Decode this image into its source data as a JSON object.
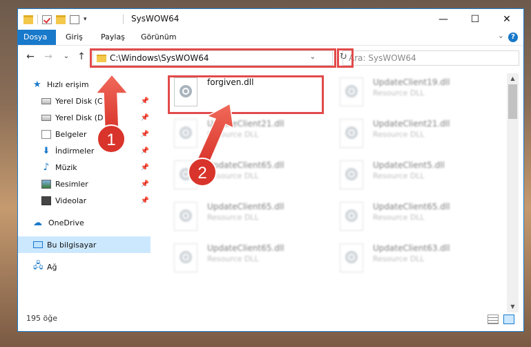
{
  "window": {
    "title": "SysWOW64"
  },
  "window_controls": {
    "minimize": "—",
    "maximize": "☐",
    "close": "✕"
  },
  "ribbon": {
    "tabs": [
      {
        "label": "Dosya",
        "active": true
      },
      {
        "label": "Giriş",
        "active": false
      },
      {
        "label": "Paylaş",
        "active": false
      },
      {
        "label": "Görünüm",
        "active": false
      }
    ],
    "help": "?",
    "expand": "⌄"
  },
  "nav_buttons": {
    "back": "←",
    "forward": "→",
    "recent": "⌄",
    "up": "↑"
  },
  "address": {
    "path": "C:\\Windows\\SysWOW64",
    "chevron": "⌄",
    "refresh": "↻"
  },
  "search": {
    "placeholder": "Ara: SysWOW64"
  },
  "sidebar": {
    "items": [
      {
        "label": "Hızlı erişim"
      },
      {
        "label": "Yerel Disk (C:)",
        "pinned": true
      },
      {
        "label": "Yerel Disk (D:)",
        "pinned": true
      },
      {
        "label": "Belgeler",
        "pinned": true
      },
      {
        "label": "İndirmeler",
        "pinned": true
      },
      {
        "label": "Müzik",
        "pinned": true
      },
      {
        "label": "Resimler",
        "pinned": true
      },
      {
        "label": "Videolar",
        "pinned": true
      },
      {
        "label": "OneDrive"
      },
      {
        "label": "Bu bilgisayar",
        "selected": true
      },
      {
        "label": "Ağ"
      }
    ]
  },
  "files": [
    {
      "name": "forgiven.dll",
      "type": "",
      "focused": true
    },
    {
      "name": "UpdateClient19.dll",
      "type": "Resource DLL"
    },
    {
      "name": "UpdateClient21.dll",
      "type": "Resource DLL"
    },
    {
      "name": "UpdateClient21.dll",
      "type": "Resource DLL"
    },
    {
      "name": "UpdateClient65.dll",
      "type": "Resource DLL"
    },
    {
      "name": "UpdateClient5.dll",
      "type": "Resource DLL"
    },
    {
      "name": "UpdateClient65.dll",
      "type": "Resource DLL"
    },
    {
      "name": "UpdateClient65.dll",
      "type": "Resource DLL"
    },
    {
      "name": "UpdateClient65.dll",
      "type": "Resource DLL"
    },
    {
      "name": "UpdateClient63.dll",
      "type": "Resource DLL"
    }
  ],
  "status": {
    "item_count": "195 öğe"
  },
  "callouts": [
    {
      "label": "1"
    },
    {
      "label": "2"
    }
  ],
  "colors": {
    "accent": "#1979ca",
    "highlight": "#e24a4a",
    "callout": "#d9342b"
  }
}
